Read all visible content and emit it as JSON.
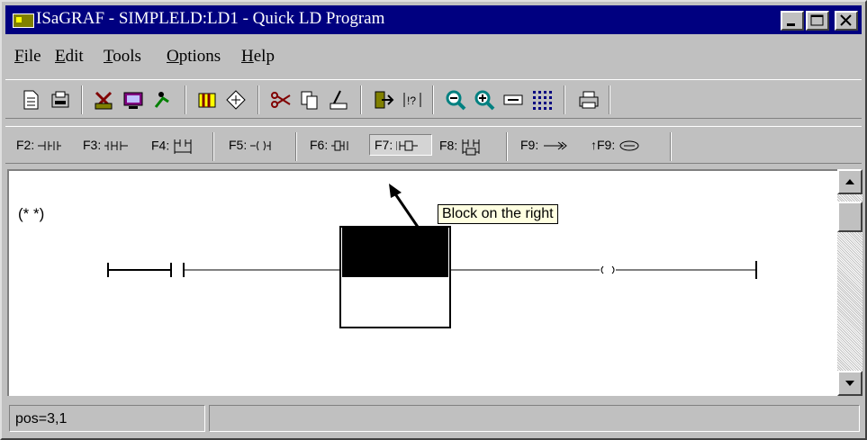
{
  "window": {
    "title": "ISaGRAF - SIMPLELD:LD1 - Quick LD Program"
  },
  "menu": [
    {
      "label": "File",
      "mnemonic": "F",
      "rest": "ile"
    },
    {
      "label": "Edit",
      "mnemonic": "E",
      "rest": "dit"
    },
    {
      "label": "Tools",
      "mnemonic": "T",
      "rest": "ools"
    },
    {
      "label": "Options",
      "mnemonic": "O",
      "rest": "ptions"
    },
    {
      "label": "Help",
      "mnemonic": "H",
      "rest": "elp"
    }
  ],
  "toolbar": {
    "icons": [
      "new-document-icon",
      "print-preview-icon",
      "library-icon",
      "monitor-icon",
      "debug-icon",
      "chart-icon",
      "variables-icon",
      "cut-icon",
      "copy-icon",
      "paste-icon",
      "exit-icon",
      "cross-reference-icon",
      "zoom-out-icon",
      "zoom-in-icon",
      "contact-icon",
      "grid-icon",
      "printer-icon"
    ]
  },
  "fkeys": {
    "f2": "F2:",
    "f3": "F3:",
    "f4": "F4:",
    "f5": "F5:",
    "f6": "F6:",
    "f7": "F7:",
    "f8": "F8:",
    "f9": "F9:",
    "sf9": "↑F9:"
  },
  "editor": {
    "comment": "(* *)",
    "tooltip": "Block on the right"
  },
  "status": {
    "position": "pos=3,1"
  },
  "colors": {
    "title_bg": "#000080",
    "face": "#c0c0c0",
    "tooltip_bg": "#ffffe1"
  }
}
